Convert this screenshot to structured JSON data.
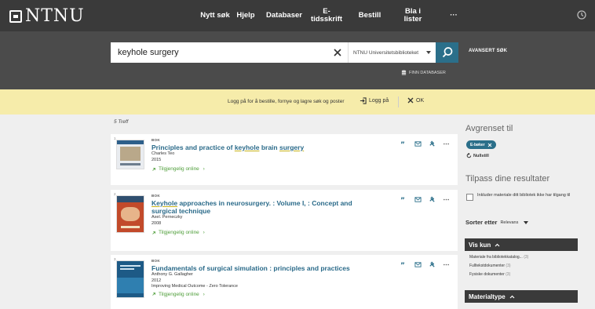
{
  "nav": {
    "logo": "NTNU",
    "items": [
      "Nytt søk",
      "Hjelp",
      "Databaser",
      "E-\ntidsskrift",
      "Bestill",
      "Bla i\nlister",
      "···"
    ]
  },
  "search": {
    "query": "keyhole surgery",
    "scope": "NTNU Universitetsbiblioteket",
    "advanced": "AVANSERT SØK",
    "find_db": "FINN DATABASER"
  },
  "banner": {
    "text": "Logg på for å bestille, fornye og lagre søk og poster",
    "login": "Logg på",
    "ok": "OK"
  },
  "results": {
    "count": "5 Treff",
    "items": [
      {
        "num": "1",
        "type": "BOK",
        "title_parts": [
          "Principles and practice of ",
          "keyhole",
          " brain ",
          "surgery"
        ],
        "author": "Charles Teo",
        "year": "2015",
        "series": "",
        "online": "Tilgjengelig online"
      },
      {
        "num": "2",
        "type": "BOK",
        "title_parts": [
          "Keyhole",
          " approaches in neurosurgery. : Volume I, : Concept and surgical technique"
        ],
        "author": "Axel. Perneczky",
        "year": "2008",
        "series": "",
        "online": "Tilgjengelig online"
      },
      {
        "num": "3",
        "type": "BOK",
        "title_parts": [
          "Fundamentals of surgical simulation : principles and practices"
        ],
        "author": "Anthony G. Gallagher",
        "year": "2012",
        "series": "Improving Medical Outcome - Zero Tolerance",
        "online": "Tilgjengelig online"
      }
    ]
  },
  "sidebar": {
    "refine_title": "Avgrenset til",
    "chip": "E-bøker",
    "reset": "Nullstill",
    "customize_title": "Tilpass dine resultater",
    "include_label": "Inkluder materiale ditt bibliotek ikke har tilgang til",
    "sort_label": "Sorter etter",
    "sort_value": "Relevans",
    "show_only": "Vis kun",
    "facets": [
      {
        "label": "Materiale fra bibliotekkatalog...",
        "count": "(3)"
      },
      {
        "label": "Fulltekstdokumenter",
        "count": "(3)"
      },
      {
        "label": "Fysiske dokumenter",
        "count": "(3)"
      }
    ],
    "material_type": "Materialtype"
  },
  "colors": {
    "nav_bg": "#3a3a3a",
    "search_bg": "#4b4b4b",
    "accent": "#2b6f8a",
    "banner": "#f6ecaa",
    "online": "#4f9e3a"
  }
}
